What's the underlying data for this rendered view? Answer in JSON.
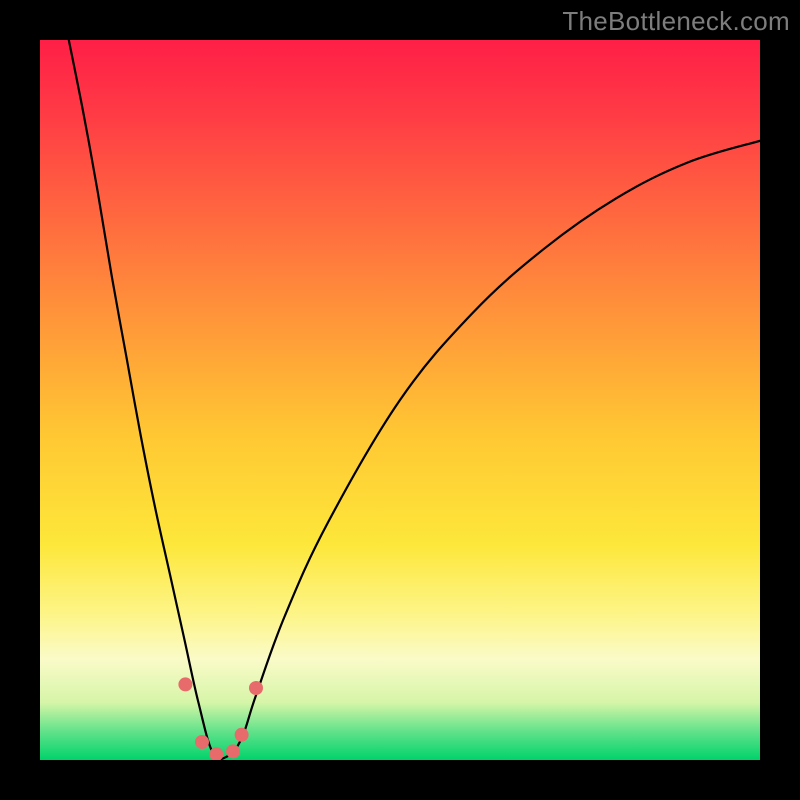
{
  "watermark_text": "TheBottleneck.com",
  "colors": {
    "background_frame": "#000000",
    "curve_stroke": "#000000",
    "marker_fill": "#e76b6b",
    "gradient_stops": [
      "#ff1f47",
      "#ff3a45",
      "#ff6a3f",
      "#ff9a39",
      "#ffc833",
      "#fde73a",
      "#fdf58a",
      "#fafbc8",
      "#d6f5a8",
      "#62e28a",
      "#00d36b"
    ]
  },
  "chart_data": {
    "type": "line",
    "title": "",
    "xlabel": "",
    "ylabel": "",
    "xlim": [
      0,
      100
    ],
    "ylim": [
      0,
      100
    ],
    "note": "Bottleneck-style curve. x/y in percent of plot area (y=0 bottom, y=100 top). Curve shows bottleneck % vs relative component strength; minimum ~0 at x≈23–27; background hue encodes the same value (green=low bottleneck, red=high).",
    "series": [
      {
        "name": "bottleneck_curve",
        "x": [
          4,
          6,
          8,
          10,
          12,
          14,
          16,
          18,
          20,
          22,
          24,
          26,
          28,
          30,
          34,
          40,
          50,
          60,
          70,
          80,
          90,
          100
        ],
        "y": [
          100,
          90,
          79,
          67,
          56,
          45,
          35,
          26,
          17,
          8,
          1,
          0.5,
          3,
          9,
          20,
          33,
          50,
          62,
          71,
          78,
          83,
          86
        ]
      }
    ],
    "markers": [
      {
        "x": 20.2,
        "y": 10.5
      },
      {
        "x": 22.5,
        "y": 2.5
      },
      {
        "x": 24.5,
        "y": 0.8
      },
      {
        "x": 26.8,
        "y": 1.2
      },
      {
        "x": 28.0,
        "y": 3.5
      },
      {
        "x": 30.0,
        "y": 10.0
      }
    ]
  }
}
